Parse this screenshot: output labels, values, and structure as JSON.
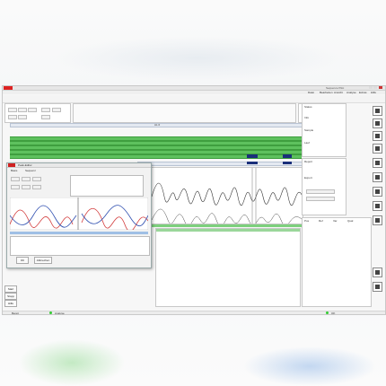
{
  "window": {
    "title": "Sequence Pilot",
    "menu": [
      "Datei",
      "Bearbeiten",
      "Ansicht",
      "Analyse",
      "Extras",
      "Hilfe"
    ]
  },
  "alignment": {
    "ruler_label": "AL.0",
    "region_label": "Alignment - ABC: 1.2.3"
  },
  "dialog": {
    "title": "Peak-Editor",
    "tabs": [
      "Basis",
      "Sequenz"
    ],
    "ok_label": "OK",
    "cancel_label": "Abbrechen"
  },
  "right_panel": {
    "labels": [
      "Status",
      "Info",
      "Sample",
      "Lauf",
      "Report",
      "Export"
    ],
    "table_headers": [
      "Pos",
      "Ref",
      "Var",
      "Qual"
    ]
  },
  "bottom": {
    "buttons": [
      "Start",
      "Stopp",
      "Hilfe"
    ],
    "status_items": [
      "Bereit",
      "Analyse",
      "OK"
    ]
  },
  "colors": {
    "track_green": "#5ec15e",
    "selection_blue": "#1a2f7a",
    "app_badge": "#dd2222",
    "trace_red": "#d23a3a",
    "trace_blue": "#2f4fb0"
  }
}
